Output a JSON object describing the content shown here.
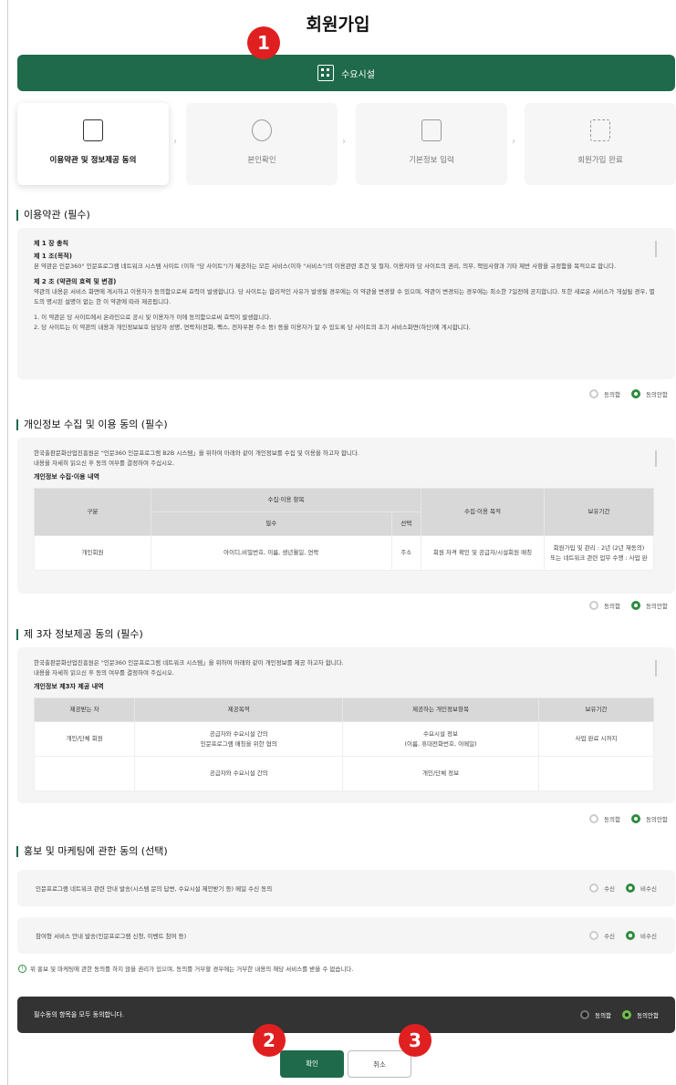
{
  "page_title": "회원가입",
  "user_type": "수요시설",
  "steps": [
    {
      "label": "이용약관 및 정보제공 동의",
      "active": true
    },
    {
      "label": "본인확인",
      "active": false
    },
    {
      "label": "기본정보 입력",
      "active": false
    },
    {
      "label": "회원가입 완료",
      "active": false
    }
  ],
  "terms": {
    "title": "이용약관 (필수)",
    "chapter": "제 1 장 총칙",
    "art1_title": "제 1 조(목적)",
    "art1_body": "본 약관은 인문360° 인문프로그램 네트워크 시스템 사이트 (이하 \"당 사이트\")가 제공하는 모든 서비스(이하 \"서비스\")의 이용관련 조건 및 절차, 이용자와 당 사이트의 권리, 의무, 책임사항과 기타 제반 사항을 규정함을 목적으로 합니다.",
    "art2_title": "제 2 조 (약관의 효력 및 변경)",
    "art2_body": "약관의 내용은 서비스 화면에 게시하고 이용자가 동의함으로써 효력이 발생합니다. 당 사이트는 합리적인 사유가 발생될 경우에는 이 약관을 변경할 수 있으며, 약관이 변경되는 경우에는 최소한 7일전에 공지합니다. 또한 새로운 서비스가 개설될 경우, 별도의 명시된 설명이 없는 한 이 약관에 따라 제공됩니다.",
    "item1": "1. 이 약관은 당 사이트에서 온라인으로 공시 및 이용자가 이에 동의함으로써 효력이 발생합니다.",
    "item2": "2. 당 사이트는 이 약관의 내용과 개인정보보호 담당자 성명, 연락처(전화, 팩스, 전자우편 주소 등) 등을 이용자가 알 수 있도록 당 사이트의 초기 서비스화면(하단)에 게시합니다.",
    "agree": "동의함",
    "disagree": "동의안함"
  },
  "privacy": {
    "title": "개인정보 수집 및 이용 동의 (필수)",
    "intro1": "한국출판문화산업진흥원은 \"인문360 인문프로그램 B2B 시스템」을 위하여 아래와 같이 개인정보를 수집 및 이용을 하고자 합니다.",
    "intro2": "내용을 자세히 읽으신 후 동의 여부를 결정하여 주십시오.",
    "subtitle": "개인정보 수집·이용 내역",
    "th_type": "구분",
    "th_items": "수집·이용 항목",
    "th_required": "필수",
    "th_optional": "선택",
    "th_purpose": "수집·이용 목적",
    "th_period": "보유기간",
    "row_type": "개인회원",
    "row_required": "아이디,비밀번호, 이름, 생년월일, 연락",
    "row_optional": "주소",
    "row_purpose": "회원 자격 확인 및 공급자/시설회원 매칭",
    "row_period1": "회원가입 및 관리 : 2년 (2년 재동의)",
    "row_period2": "또는 네트워크 관련 업무 수행 : 사업 완",
    "agree": "동의함",
    "disagree": "동의안함"
  },
  "third_party": {
    "title": "제 3자 정보제공 동의 (필수)",
    "intro1": "한국출판문화산업진흥원은 \"인문360 인문프로그램 네트워크 시스템」을 위하여 아래와 같이 개인정보를 제공 하고자 합니다.",
    "intro2": "내용을 자세히 읽으신 후 동의 여부를 결정하여 주십시오.",
    "subtitle": "개인정보 제3자 제공 내역",
    "th_recipient": "제공받는 자",
    "th_purpose": "제공목적",
    "th_items": "제공하는 개인정보항목",
    "th_period": "보유기간",
    "row_recipient": "개인/단체 회원",
    "row_purpose1": "공급자와 수요시설 간의",
    "row_purpose2": "인문프로그램 매칭을 위한 협의",
    "row_items1": "수요시설 정보",
    "row_items2": "(이름, 휴대전화번호, 이메일)",
    "row_period": "사업 완료 시까지",
    "row2_purpose": "공급자와 수요시설 간의",
    "row2_items": "개인/단체 정보",
    "agree": "동의함",
    "disagree": "동의안함"
  },
  "marketing": {
    "title": "홍보 및 마케팅에 관한 동의 (선택)",
    "row1": "인문프로그램 네트워크 관련 안내 발송(시스템 문의 답변, 수요시설 제안받기 등) 메일 수신 동의",
    "row2": "참여형 서비스 안내 발송(인문프로그램 신청, 이벤트 참여 등)",
    "receive": "수신",
    "reject": "비수신"
  },
  "notice": "위 홍보 및 마케팅에 관한 동의를 하지 않을 권리가 있으며, 동의를 거부할 경우에는 거부한 내용의 해당 서비스를 받을 수 없습니다.",
  "all_agree": {
    "label": "필수동의 항목을 모두 동의합니다.",
    "agree": "동의함",
    "disagree": "동의안함"
  },
  "buttons": {
    "confirm": "확인",
    "cancel": "취소"
  },
  "badges": [
    "1",
    "2",
    "3"
  ],
  "colors": {
    "brand_green": "#1e6a4a",
    "badge_red": "#e02020",
    "radio_green": "#2e8b3e"
  }
}
